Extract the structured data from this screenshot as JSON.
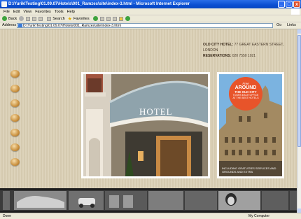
{
  "window": {
    "title": "D:\\Yurik\\Testing\\01.09.07\\Hotels\\001_Ramzes\\site\\index-3.html - Microsoft Internet Explorer",
    "min_label": "_",
    "max_label": "□",
    "close_label": "x"
  },
  "menu": {
    "items": [
      "File",
      "Edit",
      "View",
      "Favorites",
      "Tools",
      "Help"
    ]
  },
  "toolbar": {
    "back_label": "Back",
    "search_label": "Search",
    "favorites_label": "Favorites"
  },
  "address": {
    "label": "Address",
    "value": "D:\\Yurik\\Testing\\01.09.07\\Hotels\\001_Ramzes\\site\\index-3.html",
    "go_label": "Go",
    "links_label": "Links"
  },
  "page": {
    "contact": {
      "hotel_label": "OLD CITY HOTEL:",
      "address": "77 GREAT EASTERN STREET, LONDON",
      "reservations_label": "RESERVATIONS:",
      "phone": "020 7550 1021"
    },
    "awning_text": "HOTEL",
    "badge": {
      "free": "Free",
      "line1": "AROUND",
      "line2": "THE OLD CITY",
      "line3": "TOURS EACH OFFICE",
      "line4": "AT THE BEST HOTELS"
    },
    "side_caption": "INCLUDING GRATUITIES SERVICES AND GROUNDS AND EXTRA"
  },
  "status": {
    "left": "Done",
    "right": "My Computer"
  },
  "colors": {
    "accent": "#e8542a",
    "titlebar": "#0a4fd1",
    "page_bg": "#d9cfb6"
  }
}
